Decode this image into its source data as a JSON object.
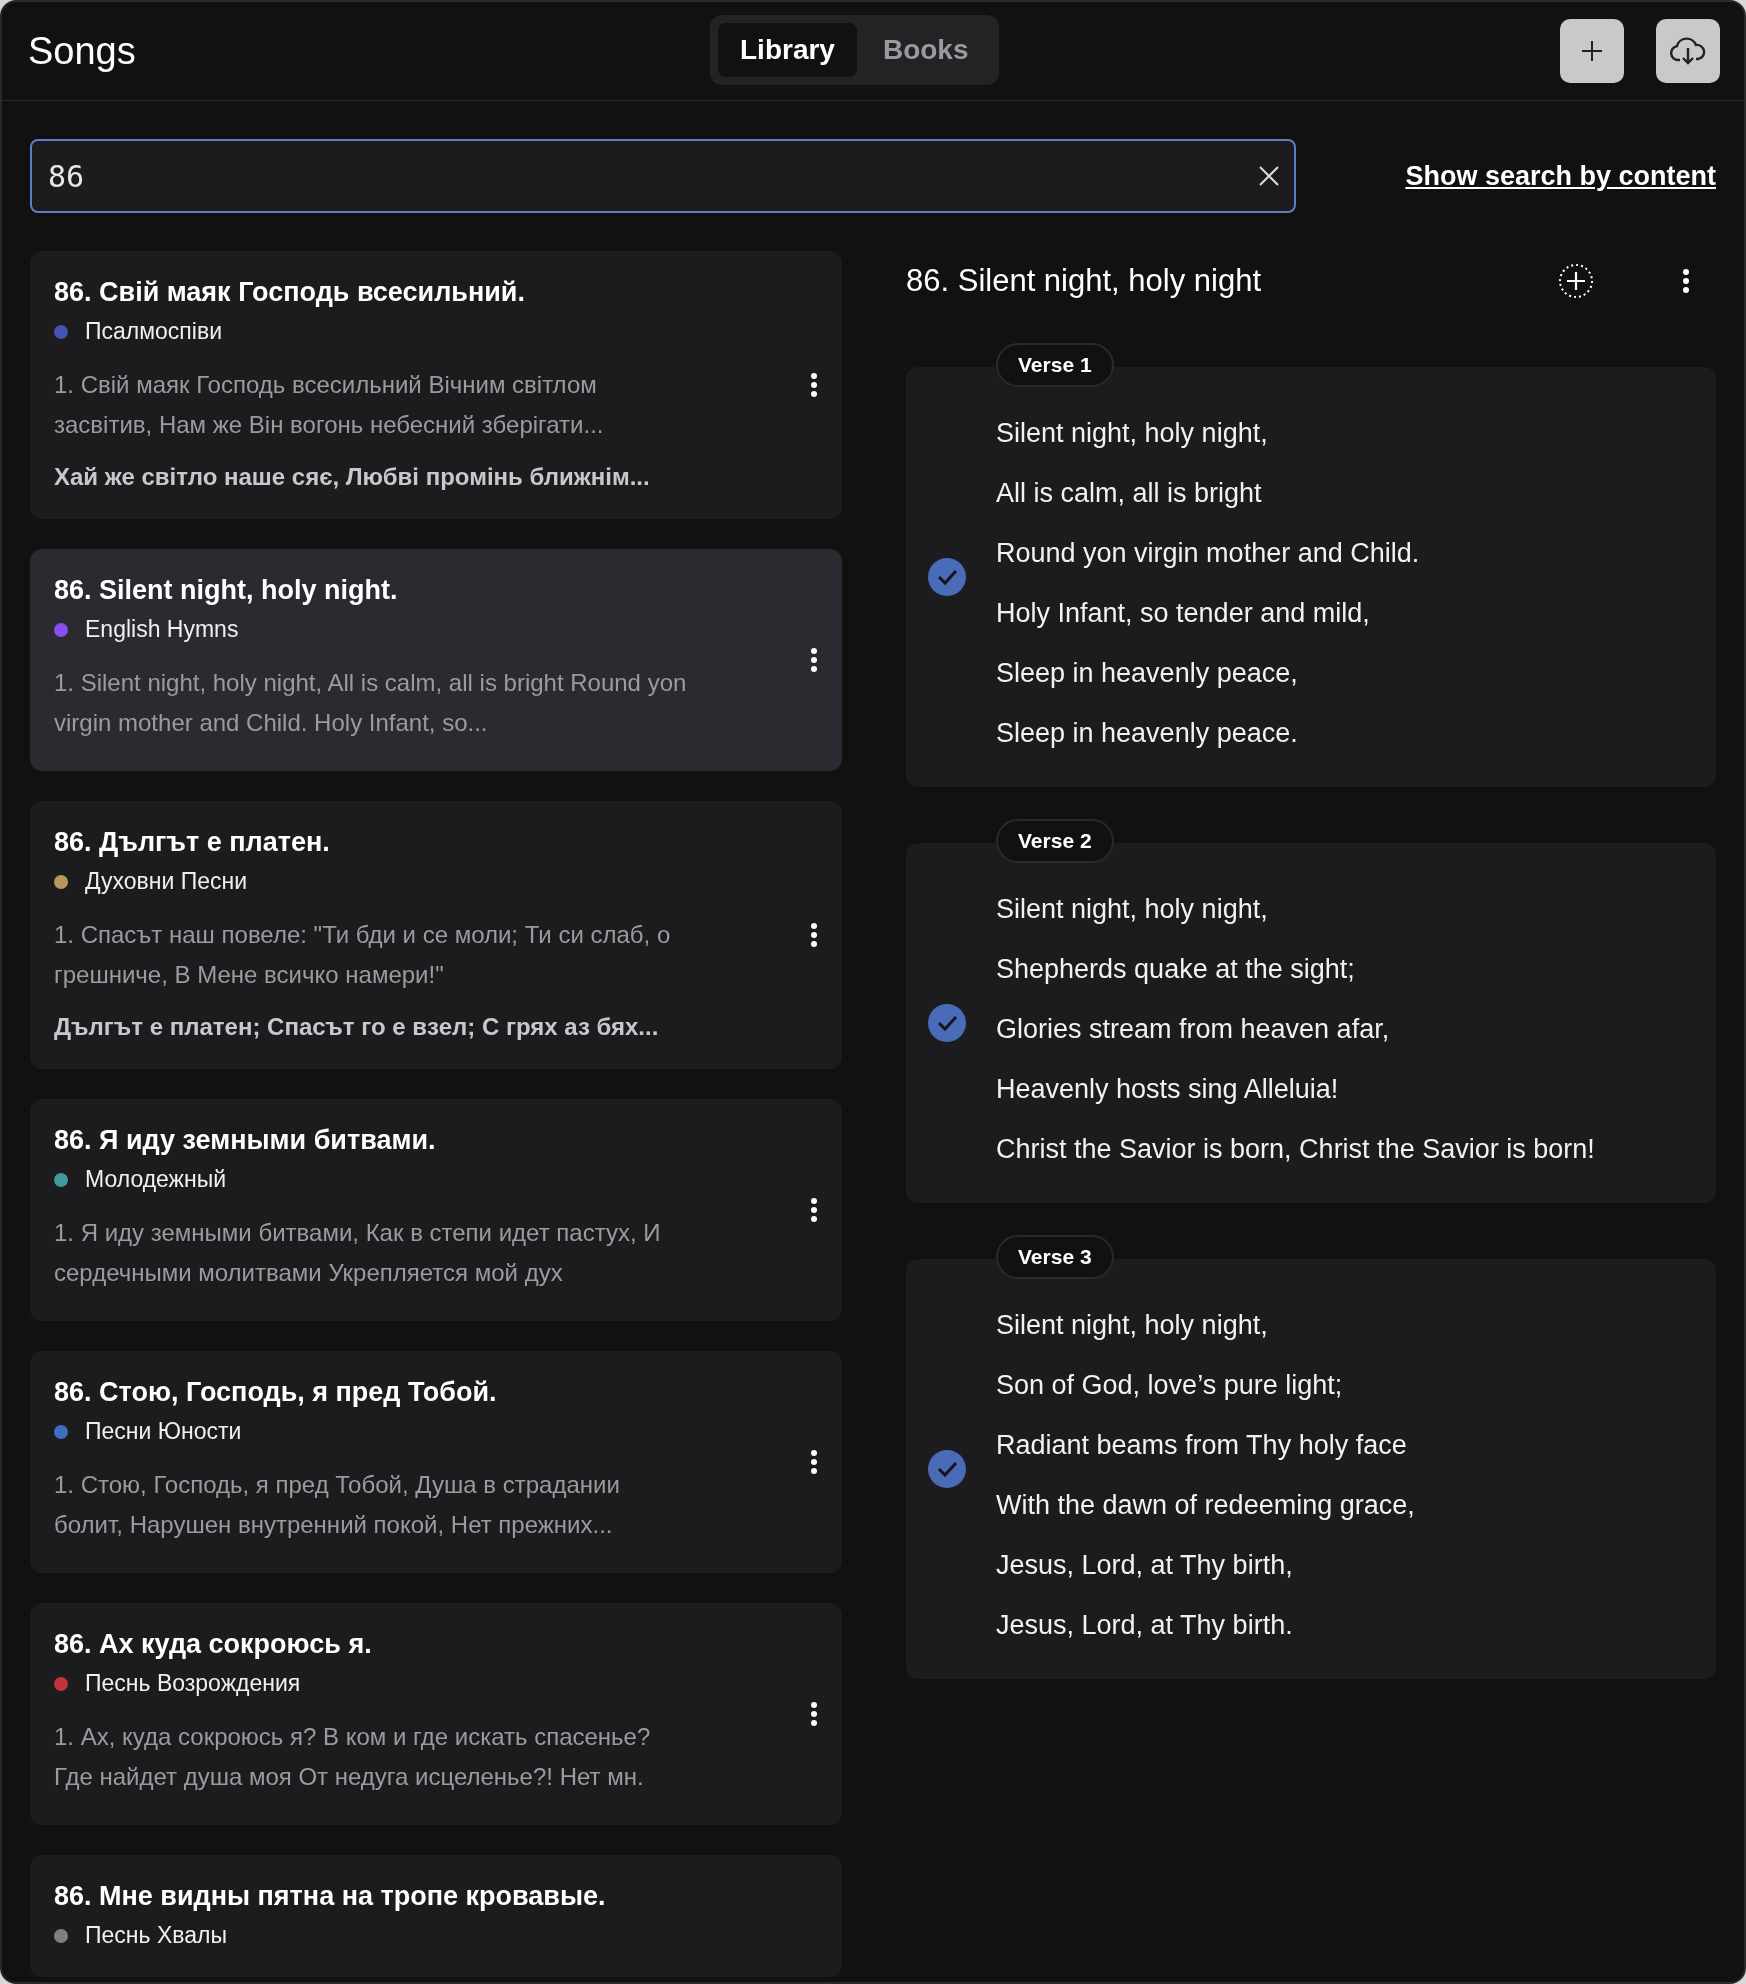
{
  "header": {
    "title": "Songs",
    "tabs": [
      {
        "label": "Library",
        "selected": true
      },
      {
        "label": "Books",
        "selected": false
      }
    ]
  },
  "search": {
    "value": "86",
    "link": "Show search by content"
  },
  "songs": [
    {
      "title": "86. Свій маяк Господь всесильний.",
      "book": "Псалмоспіви",
      "color": "#4452b0",
      "preview": "1. Свій маяк Господь всесильний Вічним світлом засвітив, Нам же Він вогонь небесний зберігати...",
      "chorus": "Хай же світло наше сяє, Любві промінь ближнім...",
      "selected": false
    },
    {
      "title": "86. Silent night, holy night.",
      "book": "English Hymns",
      "color": "#8b4cf0",
      "preview": "1. Silent night, holy night, All is calm, all is bright Round yon virgin mother and Child. Holy Infant, so...",
      "selected": true
    },
    {
      "title": "86. Дългът е платен.",
      "book": "Духовни Песни",
      "color": "#b8975a",
      "preview": "1. Спасът наш повеле: \"Ти бди и се моли; Ти си слаб, о грешниче, В Мене всичко намери!\"",
      "chorus": "Дългът е платен; Спасът го е взел; С грях аз бях...",
      "selected": false
    },
    {
      "title": "86. Я иду земными битвами.",
      "book": "Молодежный",
      "color": "#3f9a9a",
      "preview": "1. Я иду земными битвами, Как в степи идет пастух, И сердечными молитвами Укрепляется мой дух",
      "selected": false
    },
    {
      "title": "86. Стою, Господь, я пред Тобой.",
      "book": "Песни Юности",
      "color": "#3f6fc0",
      "preview": "1. Стою, Господь, я пред Тобой, Душа в страдании болит, Нарушен внутренний покой, Нет прежних...",
      "selected": false
    },
    {
      "title": "86. Ах куда сокроюсь я.",
      "book": "Песнь Возрождения",
      "color": "#c0343c",
      "preview": "1. Ах, куда сокроюсь я? В ком и где искать спасенье? Где найдет душа моя От недуга исцеленье?! Нет мн.",
      "selected": false
    },
    {
      "title": "86. Мне видны пятна на тропе кровавые.",
      "book": "Песнь Хвалы",
      "color": "#808080",
      "selected": false
    }
  ],
  "detail": {
    "title": "86. Silent night, holy night",
    "verses": [
      {
        "label": "Verse 1",
        "checked": true,
        "lines": [
          "Silent night, holy night,",
          "All is calm, all is bright",
          "Round yon virgin mother and Child.",
          "Holy Infant, so tender and mild,",
          "Sleep in heavenly peace,",
          "Sleep in heavenly peace."
        ]
      },
      {
        "label": "Verse 2",
        "checked": true,
        "lines": [
          "Silent night, holy night,",
          "Shepherds quake at the sight;",
          "Glories stream from heaven afar,",
          "Heavenly hosts sing Alleluia!",
          "Christ the Savior is born, Christ the Savior is born!"
        ]
      },
      {
        "label": "Verse 3",
        "checked": true,
        "lines": [
          "Silent night, holy night,",
          "Son of God, love’s pure light;",
          "Radiant beams from Thy holy face",
          "With the dawn of redeeming grace,",
          "Jesus, Lord, at Thy birth,",
          "Jesus, Lord, at Thy birth."
        ]
      }
    ]
  }
}
